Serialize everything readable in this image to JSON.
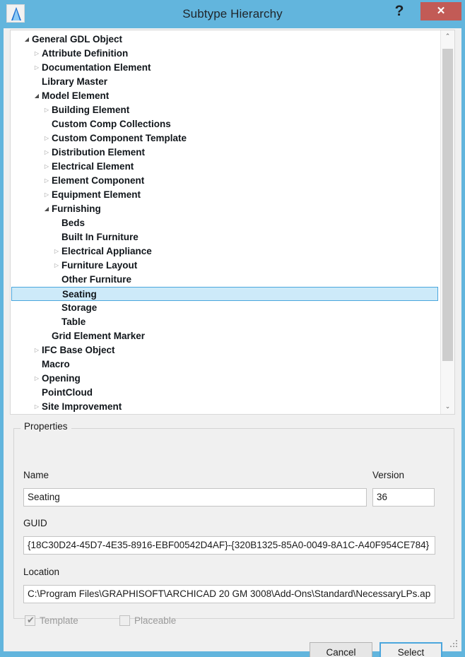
{
  "window": {
    "title": "Subtype Hierarchy",
    "app_icon": "archicad-logo-icon",
    "help_label": "?",
    "close_label": "✕"
  },
  "tree": {
    "scroll_up_glyph": "⌃",
    "scroll_down_glyph": "⌄",
    "expanded_glyph": "◢",
    "collapsed_glyph": "▷",
    "items": [
      {
        "label": "General GDL Object",
        "level": 0,
        "state": "expanded",
        "selected": false
      },
      {
        "label": "Attribute Definition",
        "level": 1,
        "state": "collapsed",
        "selected": false
      },
      {
        "label": "Documentation Element",
        "level": 1,
        "state": "collapsed",
        "selected": false
      },
      {
        "label": "Library Master",
        "level": 1,
        "state": "leaf",
        "selected": false
      },
      {
        "label": "Model Element",
        "level": 1,
        "state": "expanded",
        "selected": false
      },
      {
        "label": "Building Element",
        "level": 2,
        "state": "collapsed",
        "selected": false
      },
      {
        "label": "Custom Comp Collections",
        "level": 2,
        "state": "leaf",
        "selected": false
      },
      {
        "label": "Custom Component Template",
        "level": 2,
        "state": "collapsed",
        "selected": false
      },
      {
        "label": "Distribution Element",
        "level": 2,
        "state": "collapsed",
        "selected": false
      },
      {
        "label": "Electrical Element",
        "level": 2,
        "state": "collapsed",
        "selected": false
      },
      {
        "label": "Element Component",
        "level": 2,
        "state": "collapsed",
        "selected": false
      },
      {
        "label": "Equipment Element",
        "level": 2,
        "state": "collapsed",
        "selected": false
      },
      {
        "label": "Furnishing",
        "level": 2,
        "state": "expanded",
        "selected": false
      },
      {
        "label": "Beds",
        "level": 3,
        "state": "leaf",
        "selected": false
      },
      {
        "label": "Built In Furniture",
        "level": 3,
        "state": "leaf",
        "selected": false
      },
      {
        "label": "Electrical Appliance",
        "level": 3,
        "state": "collapsed",
        "selected": false
      },
      {
        "label": "Furniture Layout",
        "level": 3,
        "state": "collapsed",
        "selected": false
      },
      {
        "label": "Other Furniture",
        "level": 3,
        "state": "leaf",
        "selected": false
      },
      {
        "label": "Seating",
        "level": 3,
        "state": "leaf",
        "selected": true
      },
      {
        "label": "Storage",
        "level": 3,
        "state": "leaf",
        "selected": false
      },
      {
        "label": "Table",
        "level": 3,
        "state": "leaf",
        "selected": false
      },
      {
        "label": "Grid Element Marker",
        "level": 2,
        "state": "leaf",
        "selected": false
      },
      {
        "label": "IFC Base Object",
        "level": 1,
        "state": "collapsed",
        "selected": false
      },
      {
        "label": "Macro",
        "level": 1,
        "state": "leaf",
        "selected": false
      },
      {
        "label": "Opening",
        "level": 1,
        "state": "collapsed",
        "selected": false
      },
      {
        "label": "PointCloud",
        "level": 1,
        "state": "leaf",
        "selected": false
      },
      {
        "label": "Site Improvement",
        "level": 1,
        "state": "collapsed",
        "selected": false
      }
    ]
  },
  "properties": {
    "legend": "Properties",
    "name_label": "Name",
    "name_value": "Seating",
    "version_label": "Version",
    "version_value": "36",
    "guid_label": "GUID",
    "guid_value": "{18C30D24-45D7-4E35-8916-EBF00542D4AF}-{320B1325-85A0-0049-8A1C-A40F954CE784}",
    "location_label": "Location",
    "location_value": "C:\\Program Files\\GRAPHISOFT\\ARCHICAD 20 GM 3008\\Add-Ons\\Standard\\NecessaryLPs.ap",
    "template_label": "Template",
    "template_checked": true,
    "template_tick": "✔",
    "placeable_label": "Placeable",
    "placeable_checked": false
  },
  "footer": {
    "cancel_label": "Cancel",
    "select_label": "Select"
  },
  "colors": {
    "titlebar": "#62b5dd",
    "close_button": "#c25b56",
    "dialog_bg": "#f0f0f0",
    "selection_fill": "#cdeaf9",
    "selection_border": "#4ba6dd",
    "accent": "#4ba6dd"
  }
}
